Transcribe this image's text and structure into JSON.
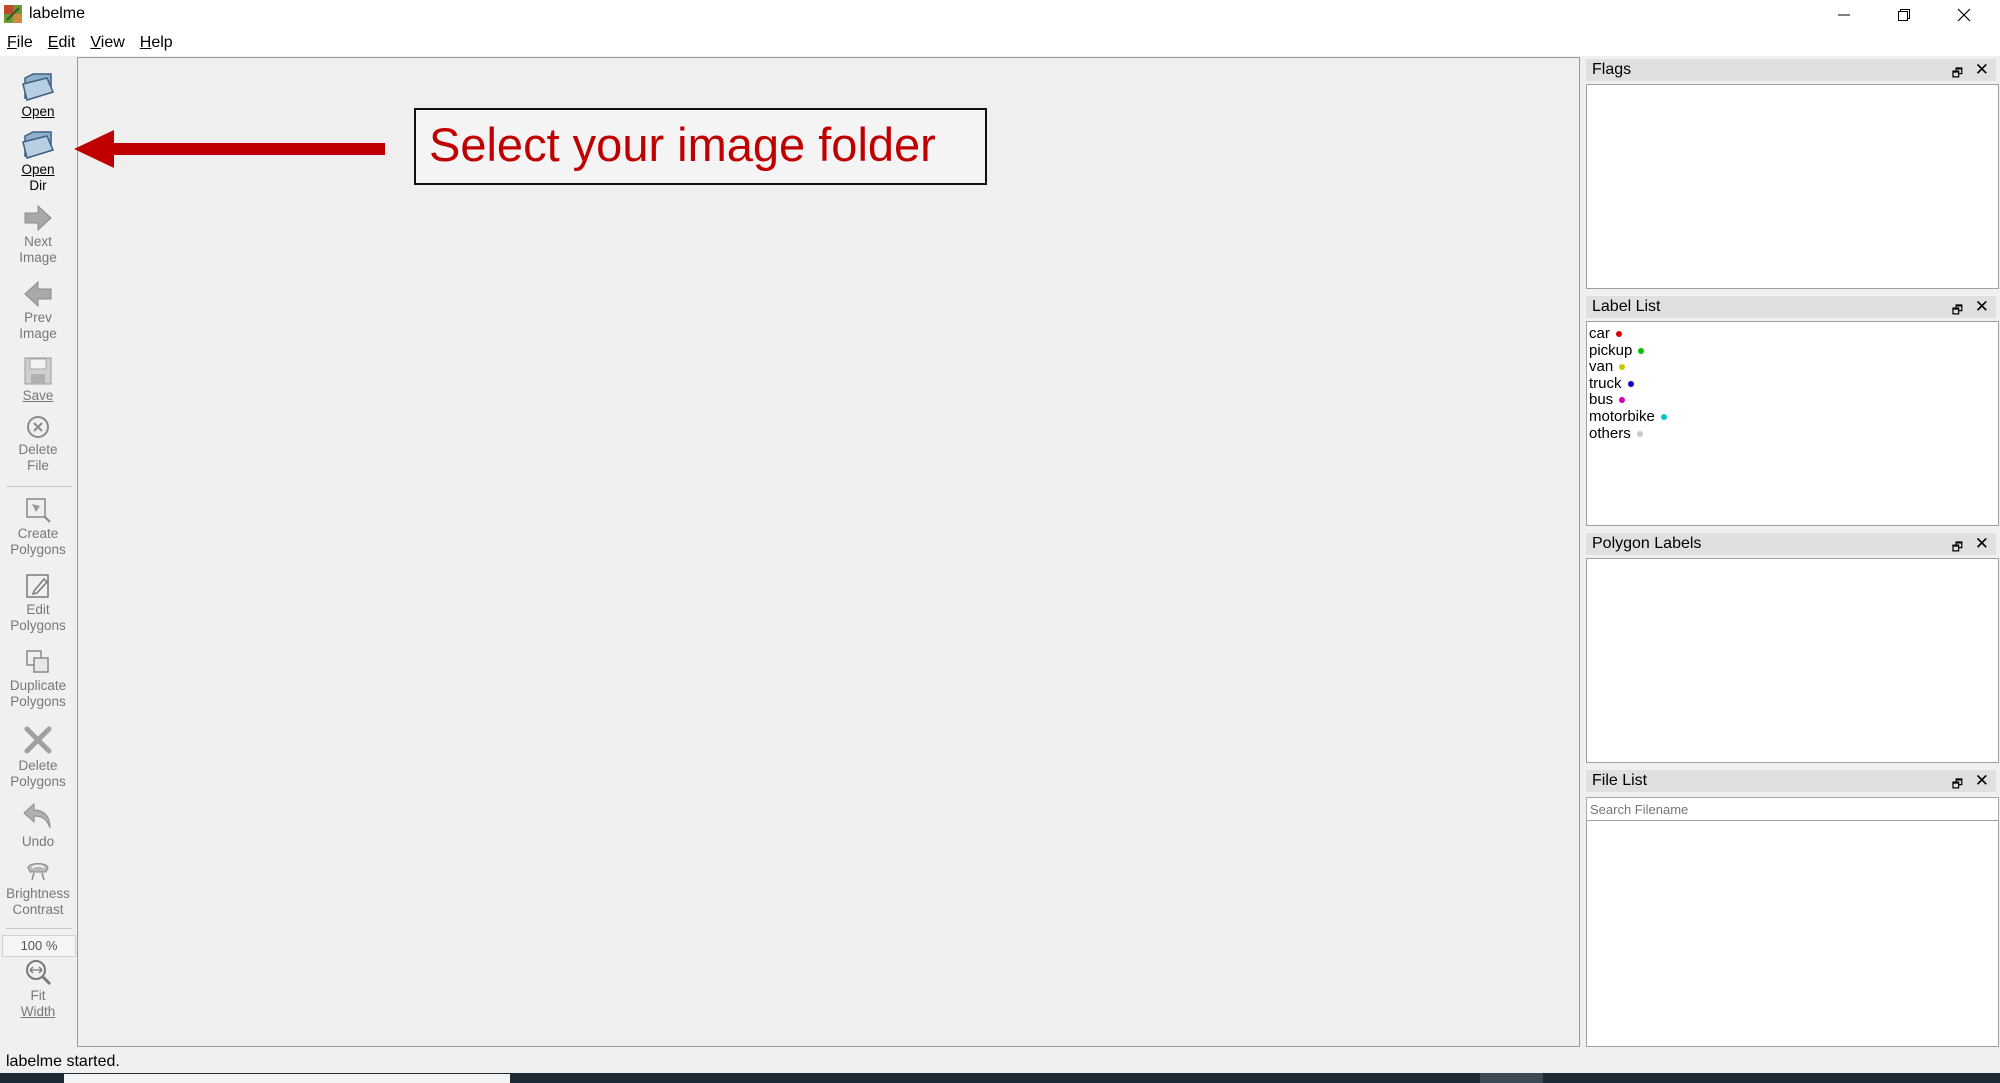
{
  "window": {
    "title": "labelme",
    "controls": [
      "minimize",
      "maximize",
      "close"
    ]
  },
  "menu": [
    {
      "label": "File",
      "u": "F",
      "rest": "ile"
    },
    {
      "label": "Edit",
      "u": "E",
      "rest": "dit"
    },
    {
      "label": "View",
      "u": "V",
      "rest": "iew"
    },
    {
      "label": "Help",
      "u": "H",
      "rest": "elp"
    }
  ],
  "toolbar": {
    "open": "Open",
    "open_dir": [
      "Open",
      "Dir"
    ],
    "next_image": [
      "Next",
      "Image"
    ],
    "prev_image": [
      "Prev",
      "Image"
    ],
    "save": "Save",
    "delete_file": [
      "Delete",
      "File"
    ],
    "create_polygons": [
      "Create",
      "Polygons"
    ],
    "edit_polygons": [
      "Edit",
      "Polygons"
    ],
    "duplicate_polygons": [
      "Duplicate",
      "Polygons"
    ],
    "delete_polygons": [
      "Delete",
      "Polygons"
    ],
    "undo": "Undo",
    "brightness_contrast": [
      "Brightness",
      "Contrast"
    ],
    "zoom": "100 %",
    "fit_width": [
      "Fit",
      "Width"
    ]
  },
  "annotation": {
    "text": "Select your image folder",
    "color": "#c00000"
  },
  "docks": {
    "flags": {
      "title": "Flags"
    },
    "label_list": {
      "title": "Label List",
      "labels": [
        {
          "name": "car",
          "color": "#e00000"
        },
        {
          "name": "pickup",
          "color": "#00c000"
        },
        {
          "name": "van",
          "color": "#c8c800"
        },
        {
          "name": "truck",
          "color": "#0000c8"
        },
        {
          "name": "bus",
          "color": "#c800c8"
        },
        {
          "name": "motorbike",
          "color": "#00c8c8"
        },
        {
          "name": "others",
          "color": "#c8c8c8"
        }
      ]
    },
    "polygon_labels": {
      "title": "Polygon Labels"
    },
    "file_list": {
      "title": "File List",
      "search_placeholder": "Search Filename"
    }
  },
  "status": "labelme started."
}
